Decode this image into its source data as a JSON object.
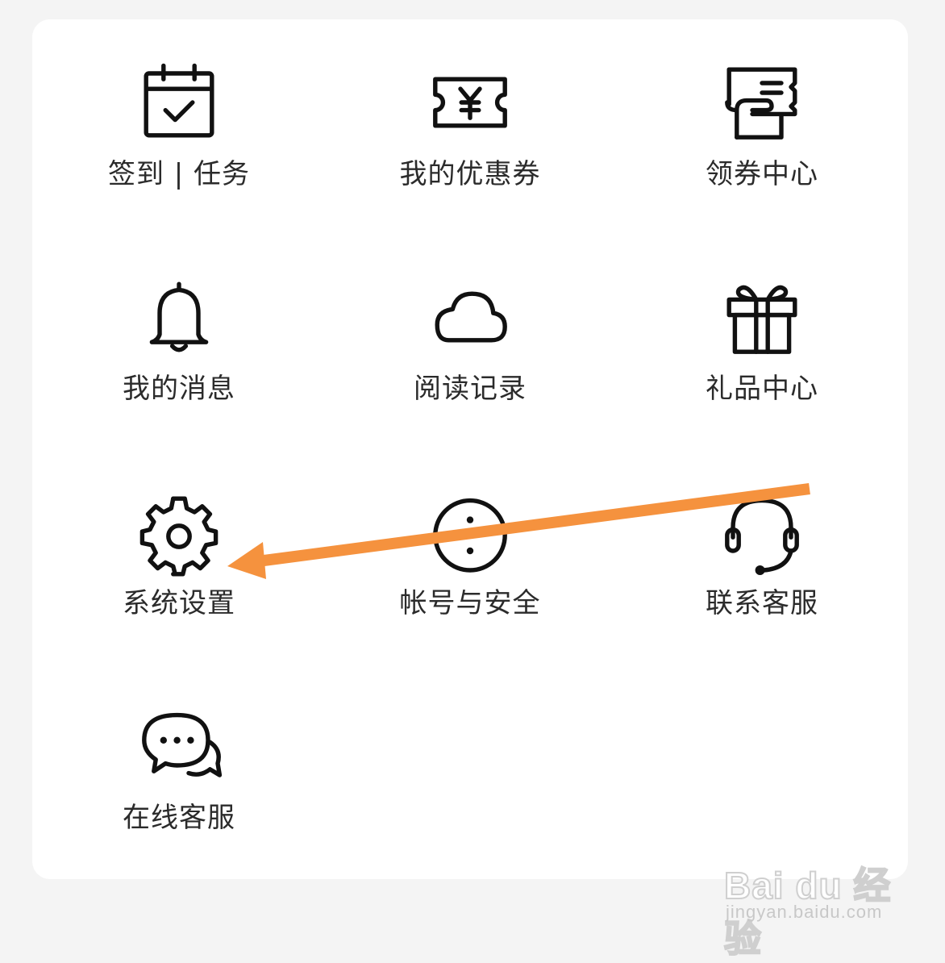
{
  "menu": {
    "items": [
      {
        "label": "签到 | 任务",
        "icon": "calendar-check-icon"
      },
      {
        "label": "我的优惠券",
        "icon": "coupon-icon"
      },
      {
        "label": "领券中心",
        "icon": "receive-coupon-icon"
      },
      {
        "label": "我的消息",
        "icon": "bell-icon"
      },
      {
        "label": "阅读记录",
        "icon": "cloud-icon"
      },
      {
        "label": "礼品中心",
        "icon": "gift-icon"
      },
      {
        "label": "系统设置",
        "icon": "gear-icon"
      },
      {
        "label": "帐号与安全",
        "icon": "more-vertical-icon"
      },
      {
        "label": "联系客服",
        "icon": "headset-icon"
      },
      {
        "label": "在线客服",
        "icon": "chat-bubbles-icon"
      }
    ]
  },
  "annotation": {
    "arrow_color": "#f5923e",
    "points_to": "系统设置"
  },
  "watermark": {
    "logo": "Bai du 经验",
    "url": "jingyan.baidu.com"
  }
}
